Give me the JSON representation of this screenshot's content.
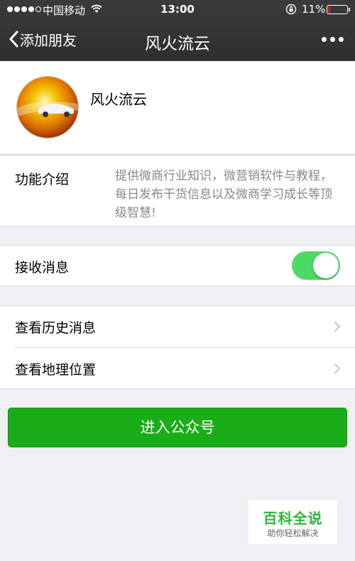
{
  "status_bar": {
    "carrier": "中国移动",
    "time": "13:00",
    "battery_percent": "11%",
    "battery_level": 0.11,
    "signal_bars_filled": 4
  },
  "nav": {
    "back_label": "添加朋友",
    "title": "风火流云",
    "icons": {
      "back": "chevron-left-icon",
      "more": "more-dots-icon"
    }
  },
  "profile": {
    "name": "风火流云"
  },
  "intro": {
    "label": "功能介绍",
    "text": "提供微商行业知识，微营销软件与教程，每日发布干货信息以及微商学习成长等顶级智慧!"
  },
  "receive_messages": {
    "label": "接收消息",
    "enabled": true
  },
  "links": [
    {
      "label": "查看历史消息"
    },
    {
      "label": "查看地理位置"
    }
  ],
  "enter_button": {
    "label": "进入公众号"
  },
  "watermark": {
    "title": "百科全说",
    "subtitle": "助你轻松解决"
  },
  "colors": {
    "nav_bg": "#2e2e30",
    "page_bg": "#efeff4",
    "toggle_on": "#4cd964",
    "primary_button": "#1aad19",
    "watermark_green": "#2db53c",
    "battery_low": "#e02020"
  }
}
